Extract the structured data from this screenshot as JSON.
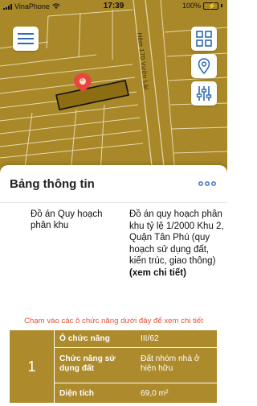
{
  "status_bar": {
    "carrier": "VinaPhone",
    "time": "17:39",
    "battery": "100%"
  },
  "map": {
    "street_label": "Hẻm 170 Vườn Lài",
    "pin_number": "1",
    "map_fill_color": "#a88828",
    "parcel_fill_color": "#8c6d12"
  },
  "panel": {
    "title": "Bảng thông tin",
    "more_icon": "ellipsis-icon",
    "plan_key": "Đồ án Quy hoạch phân khu",
    "plan_value": "Đồ án quy hoạch phân khu tỷ lệ 1/2000 Khu 2, Quận Tân Phú (quy hoạch sử dụng đất, kiến trúc, giao thông)",
    "plan_link": "(xem chi tiết)",
    "hint": "Chạm vào các ô chức năng dưới đây để xem chi tiết",
    "hint_color": "#e0533a"
  },
  "info_card": {
    "index": "1",
    "rows": [
      {
        "key": "Ô chức năng",
        "value": "III/62"
      },
      {
        "key": "Chức năng sử dụng đất",
        "value": "Đất nhóm nhà ở hiện hữu"
      },
      {
        "key": "Diện tích",
        "value": "69,0 m²"
      }
    ],
    "card_color": "#ad8a2c"
  }
}
